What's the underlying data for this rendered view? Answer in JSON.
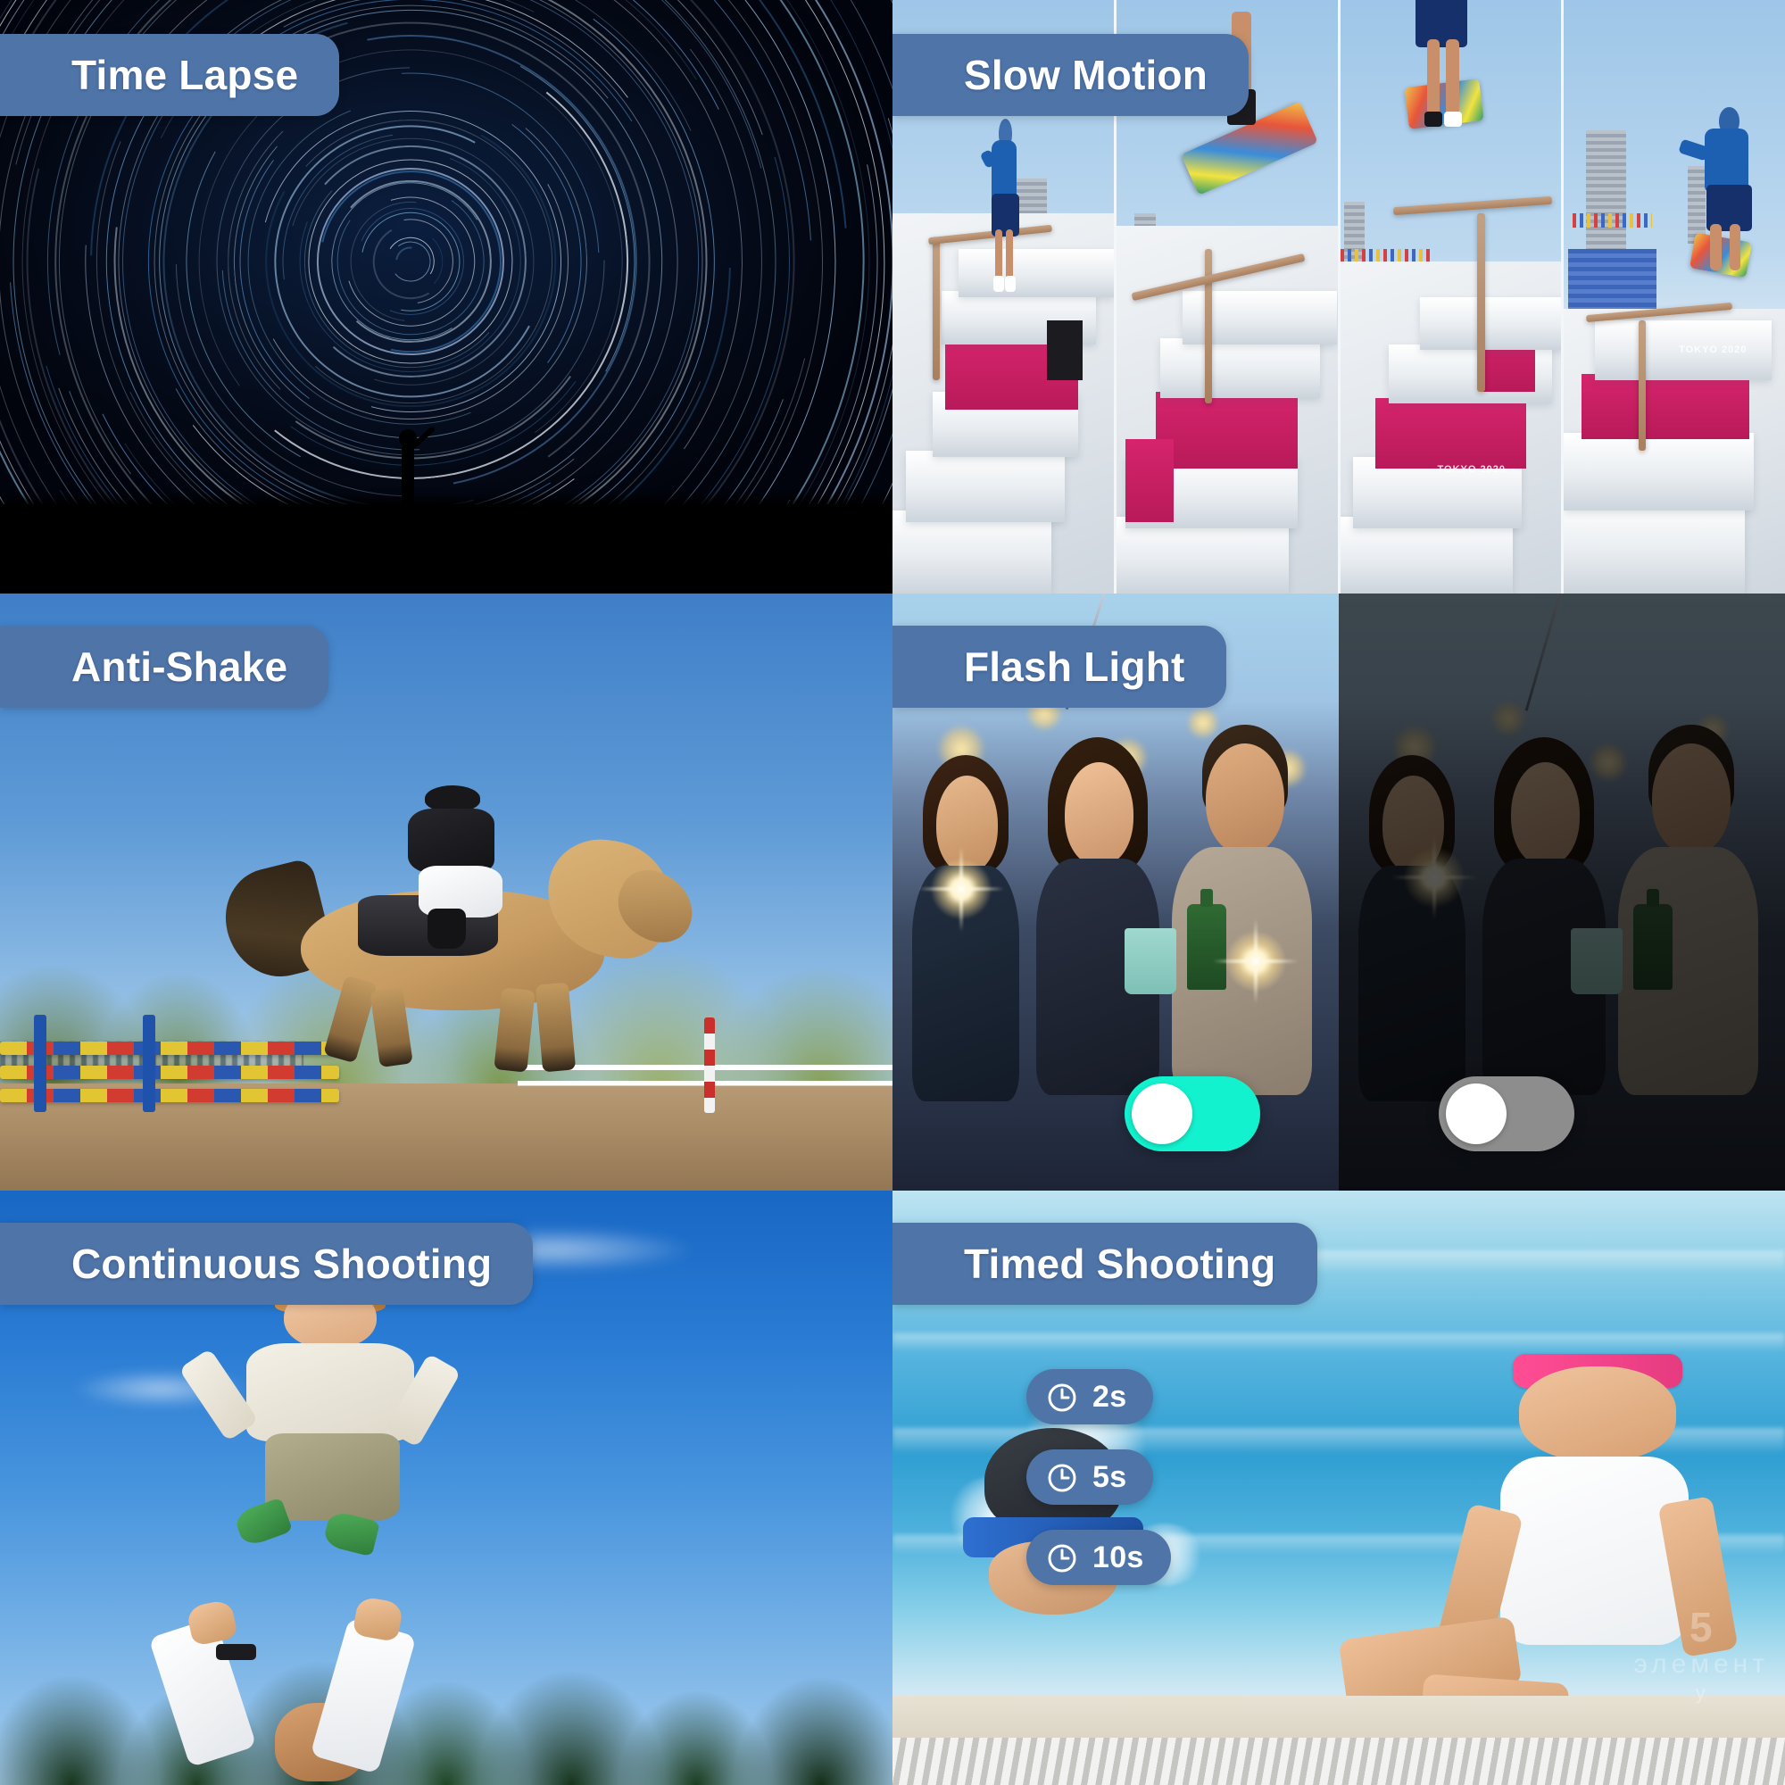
{
  "theme": {
    "pill_color": "#4F74A8",
    "pill_text_color": "#FFFFFF",
    "toggle_on_color": "#13F2CE",
    "toggle_off_color": "#8D8D8D",
    "toggle_knob_color": "#FFFFFF"
  },
  "panels": [
    {
      "id": "time-lapse",
      "label": "Time Lapse",
      "scene": "night sky star-trail long exposure with silhouetted person pointing"
    },
    {
      "id": "slow-motion",
      "label": "Slow Motion",
      "scene": "four sequential film frames of a skateboarder at an outdoor skate plaza",
      "frames": 4,
      "venue_mark": "TOKYO 2020"
    },
    {
      "id": "anti-shake",
      "label": "Anti-Shake",
      "scene": "equestrian show jumping horse and rider clearing a colored rail"
    },
    {
      "id": "flash-light",
      "label": "Flash Light",
      "scene": "friends at night with sparklers, split comparison flash on versus flash off",
      "toggles": [
        {
          "name": "flash-on",
          "state": "on",
          "label": "On"
        },
        {
          "name": "flash-off",
          "state": "off",
          "label": "Off"
        }
      ]
    },
    {
      "id": "continuous-shooting",
      "label": "Continuous Shooting",
      "scene": "adult tossing a laughing toddler into a blue sky above treetops"
    },
    {
      "id": "timed-shooting",
      "label": "Timed Shooting",
      "scene": "children in a swimming pool, girl with pink goggles at pool edge",
      "timers": [
        {
          "value": "2s",
          "icon": "clock-icon"
        },
        {
          "value": "5s",
          "icon": "clock-icon"
        },
        {
          "value": "10s",
          "icon": "clock-icon"
        }
      ]
    }
  ],
  "watermark": {
    "line1": "5",
    "line2": "элемент",
    "line3": "у"
  }
}
